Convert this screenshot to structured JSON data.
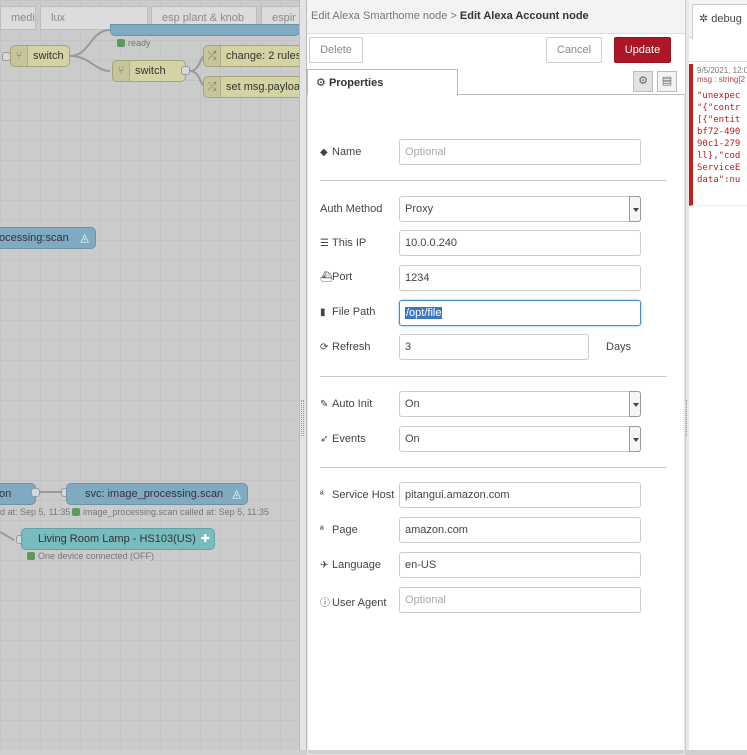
{
  "workspace": {
    "flow_tabs": [
      "media",
      "lux",
      "esp plant & knob",
      "espir"
    ],
    "nodes": {
      "switch1": "switch",
      "switch2": "switch",
      "change": "change: 2 rules",
      "set_msg": "set msg.payload",
      "processing_scan": "ocessing:scan",
      "on_node": "on",
      "svc_node": "svc: image_processing.scan",
      "lamp": "Living Room Lamp - HS103(US)"
    },
    "statuses": {
      "ready": "ready",
      "called_left": "d at: Sep 5, 11:35",
      "called_right": "image_processing.scan called at: Sep 5, 11:35",
      "lamp_status": "One device connected (OFF)"
    }
  },
  "tray": {
    "breadcrumb_parent": "Edit Alexa Smarthome node",
    "breadcrumb_sep": ">",
    "breadcrumb_current": "Edit Alexa Account node",
    "buttons": {
      "delete": "Delete",
      "cancel": "Cancel",
      "update": "Update"
    },
    "tab_properties": "Properties",
    "fields": {
      "name_label": "Name",
      "name_placeholder": "Optional",
      "auth_label": "Auth Method",
      "auth_value": "Proxy",
      "ip_label": "This IP",
      "ip_value": "10.0.0.240",
      "port_label": "Port",
      "port_value": "1234",
      "path_label": "File Path",
      "path_value": "/opt/file",
      "refresh_label": "Refresh",
      "refresh_value": "3",
      "refresh_unit": "Days",
      "autoinit_label": "Auto Init",
      "autoinit_value": "On",
      "events_label": "Events",
      "events_value": "On",
      "host_label": "Service Host",
      "host_value": "pitangui.amazon.com",
      "page_label": "Page",
      "page_value": "amazon.com",
      "lang_label": "Language",
      "lang_value": "en-US",
      "agent_label": "User Agent",
      "agent_placeholder": "Optional"
    }
  },
  "sidebar": {
    "tab_label": "debug",
    "message": {
      "time": "9/5/2021, 12:0",
      "type": "msg : string[2",
      "lines": [
        "\"unexpec",
        "\"{\"contr",
        "[{\"entit",
        "bf72-490",
        "90c1-279",
        "ll},\"cod",
        "ServiceE",
        "data\":nu"
      ]
    }
  },
  "colors": {
    "update_button": "#ad1625",
    "debug_error": "#c02020",
    "selection": "#3b78c4"
  }
}
